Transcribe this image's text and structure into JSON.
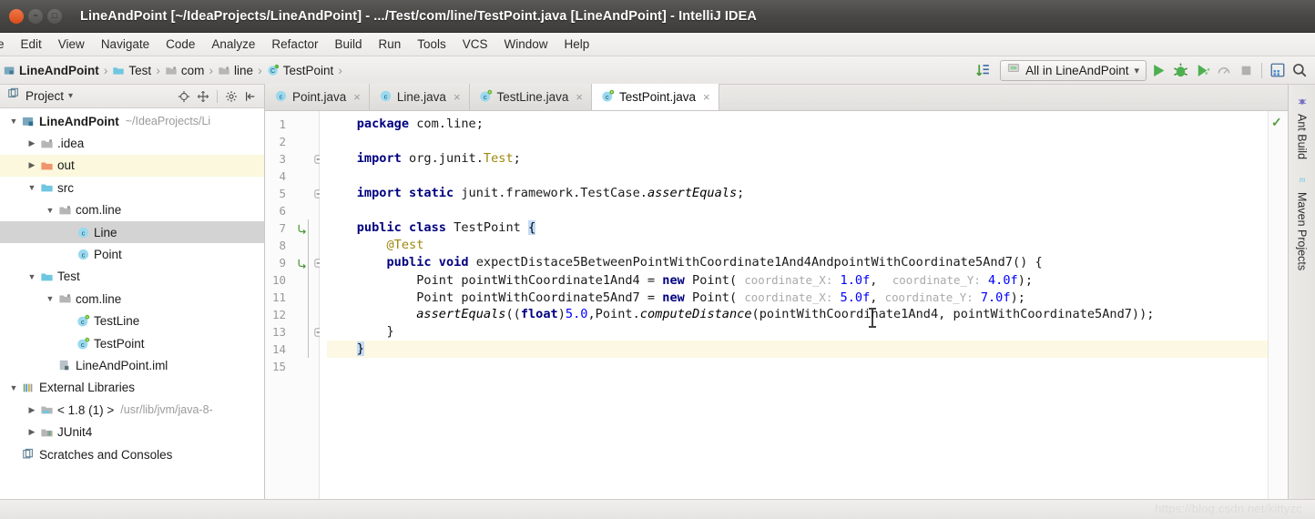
{
  "window": {
    "title": "LineAndPoint [~/IdeaProjects/LineAndPoint] - .../Test/com/line/TestPoint.java [LineAndPoint] - IntelliJ IDEA",
    "close_glyph": "×",
    "minimize_glyph": "−",
    "maximize_glyph": "□"
  },
  "menubar": {
    "items": [
      {
        "label": "le"
      },
      {
        "label": "Edit"
      },
      {
        "label": "View"
      },
      {
        "label": "Navigate"
      },
      {
        "label": "Code"
      },
      {
        "label": "Analyze"
      },
      {
        "label": "Refactor"
      },
      {
        "label": "Build"
      },
      {
        "label": "Run"
      },
      {
        "label": "Tools"
      },
      {
        "label": "VCS"
      },
      {
        "label": "Window"
      },
      {
        "label": "Help"
      }
    ]
  },
  "navbar": {
    "breadcrumbs": [
      {
        "label": "LineAndPoint",
        "icon": "module-icon"
      },
      {
        "label": "Test",
        "icon": "source-folder-icon"
      },
      {
        "label": "com",
        "icon": "folder-icon"
      },
      {
        "label": "line",
        "icon": "folder-icon"
      },
      {
        "label": "TestPoint",
        "icon": "test-class-icon"
      }
    ],
    "separator": "›",
    "run_config": "All in LineAndPoint",
    "dropdown_glyph": "▾",
    "toolbar_icons": [
      "sort-lines-icon",
      "run-icon",
      "debug-icon",
      "run-with-coverage-icon",
      "profiler-icon",
      "stop-icon",
      "settings-grid-icon",
      "search-everywhere-icon"
    ]
  },
  "sidebar": {
    "title": "Project",
    "dropdown_glyph": "▾",
    "header_icons": [
      "locate-icon",
      "expand-collapse-icon",
      "gear-icon",
      "hide-icon"
    ],
    "tree": [
      {
        "indent": 0,
        "arrow": "down",
        "icon": "module-icon",
        "label": "LineAndPoint",
        "bold": true,
        "path": "~/IdeaProjects/Li",
        "state": "normal"
      },
      {
        "indent": 1,
        "arrow": "right",
        "icon": "folder-icon",
        "label": ".idea",
        "bold": false,
        "path": "",
        "state": "normal"
      },
      {
        "indent": 1,
        "arrow": "right",
        "icon": "folder-orange-icon",
        "label": "out",
        "bold": false,
        "path": "",
        "state": "highlight"
      },
      {
        "indent": 1,
        "arrow": "down",
        "icon": "folder-src-icon",
        "label": "src",
        "bold": false,
        "path": "",
        "state": "normal"
      },
      {
        "indent": 2,
        "arrow": "down",
        "icon": "package-icon",
        "label": "com.line",
        "bold": false,
        "path": "",
        "state": "normal"
      },
      {
        "indent": 3,
        "arrow": "none",
        "icon": "class-icon",
        "label": "Line",
        "bold": false,
        "path": "",
        "state": "selected"
      },
      {
        "indent": 3,
        "arrow": "none",
        "icon": "class-icon",
        "label": "Point",
        "bold": false,
        "path": "",
        "state": "normal"
      },
      {
        "indent": 1,
        "arrow": "down",
        "icon": "folder-test-icon",
        "label": "Test",
        "bold": false,
        "path": "",
        "state": "normal"
      },
      {
        "indent": 2,
        "arrow": "down",
        "icon": "package-icon",
        "label": "com.line",
        "bold": false,
        "path": "",
        "state": "normal"
      },
      {
        "indent": 3,
        "arrow": "none",
        "icon": "test-class-icon",
        "label": "TestLine",
        "bold": false,
        "path": "",
        "state": "normal"
      },
      {
        "indent": 3,
        "arrow": "none",
        "icon": "test-class-icon",
        "label": "TestPoint",
        "bold": false,
        "path": "",
        "state": "normal"
      },
      {
        "indent": 2,
        "arrow": "none",
        "icon": "iml-file-icon",
        "label": "LineAndPoint.iml",
        "bold": false,
        "path": "",
        "state": "normal"
      },
      {
        "indent": 0,
        "arrow": "down",
        "icon": "libraries-icon",
        "label": "External Libraries",
        "bold": false,
        "path": "",
        "state": "normal"
      },
      {
        "indent": 1,
        "arrow": "right",
        "icon": "jdk-icon",
        "label": "< 1.8 (1) >",
        "bold": false,
        "path": "/usr/lib/jvm/java-8-",
        "state": "normal"
      },
      {
        "indent": 1,
        "arrow": "right",
        "icon": "library-icon",
        "label": "JUnit4",
        "bold": false,
        "path": "",
        "state": "normal"
      },
      {
        "indent": 0,
        "arrow": "none",
        "icon": "scratches-icon",
        "label": "Scratches and Consoles",
        "bold": false,
        "path": "",
        "state": "normal"
      }
    ]
  },
  "editor": {
    "tabs": [
      {
        "label": "Point.java",
        "icon": "class-icon",
        "active": false,
        "close": "×"
      },
      {
        "label": "Line.java",
        "icon": "class-icon",
        "active": false,
        "close": "×"
      },
      {
        "label": "TestLine.java",
        "icon": "test-class-icon",
        "active": false,
        "close": "×"
      },
      {
        "label": "TestPoint.java",
        "icon": "test-class-icon",
        "active": true,
        "close": "×"
      }
    ],
    "line_numbers": [
      "1",
      "2",
      "3",
      "4",
      "5",
      "6",
      "7",
      "8",
      "9",
      "10",
      "11",
      "12",
      "13",
      "14",
      "15"
    ],
    "inspection_status": "✓",
    "code_lines": [
      {
        "n": 1,
        "indent": 4,
        "caret": false,
        "tokens": [
          {
            "t": "package ",
            "c": "k"
          },
          {
            "t": "com.line;",
            "c": "pln"
          }
        ]
      },
      {
        "n": 2,
        "indent": 4,
        "caret": false,
        "tokens": []
      },
      {
        "n": 3,
        "indent": 4,
        "caret": false,
        "tokens": [
          {
            "t": "import ",
            "c": "k"
          },
          {
            "t": "org.junit.",
            "c": "pln"
          },
          {
            "t": "Test",
            "c": "an"
          },
          {
            "t": ";",
            "c": "pln"
          }
        ]
      },
      {
        "n": 4,
        "indent": 4,
        "caret": false,
        "tokens": []
      },
      {
        "n": 5,
        "indent": 4,
        "caret": false,
        "tokens": [
          {
            "t": "import static ",
            "c": "k"
          },
          {
            "t": "junit.framework.TestCase.",
            "c": "pln"
          },
          {
            "t": "assertEquals",
            "c": "it"
          },
          {
            "t": ";",
            "c": "pln"
          }
        ]
      },
      {
        "n": 6,
        "indent": 4,
        "caret": false,
        "tokens": []
      },
      {
        "n": 7,
        "indent": 4,
        "caret": false,
        "tokens": [
          {
            "t": "public class ",
            "c": "k"
          },
          {
            "t": "TestPoint ",
            "c": "pln"
          },
          {
            "t": "{",
            "c": "brmatch"
          }
        ]
      },
      {
        "n": 8,
        "indent": 8,
        "caret": false,
        "tokens": [
          {
            "t": "@Test",
            "c": "an"
          }
        ]
      },
      {
        "n": 9,
        "indent": 8,
        "caret": false,
        "tokens": [
          {
            "t": "public void ",
            "c": "k"
          },
          {
            "t": "expectDistace5BetweenPointWithCoordinate1And4AndpointWithCoordinate5And7() {",
            "c": "pln"
          }
        ]
      },
      {
        "n": 10,
        "indent": 12,
        "caret": false,
        "tokens": [
          {
            "t": "Point pointWithCoordinate1And4 = ",
            "c": "pln"
          },
          {
            "t": "new ",
            "c": "k"
          },
          {
            "t": "Point( ",
            "c": "pln"
          },
          {
            "t": "coordinate_X:",
            "c": "hint"
          },
          {
            "t": " ",
            "c": "pln"
          },
          {
            "t": "1.0f",
            "c": "num"
          },
          {
            "t": ",  ",
            "c": "pln"
          },
          {
            "t": "coordinate_Y:",
            "c": "hint"
          },
          {
            "t": " ",
            "c": "pln"
          },
          {
            "t": "4.0f",
            "c": "num"
          },
          {
            "t": ");",
            "c": "pln"
          }
        ]
      },
      {
        "n": 11,
        "indent": 12,
        "caret": false,
        "tokens": [
          {
            "t": "Point pointWithCoordinate5And7 = ",
            "c": "pln"
          },
          {
            "t": "new ",
            "c": "k"
          },
          {
            "t": "Point( ",
            "c": "pln"
          },
          {
            "t": "coordinate_X:",
            "c": "hint"
          },
          {
            "t": " ",
            "c": "pln"
          },
          {
            "t": "5.0f",
            "c": "num"
          },
          {
            "t": ", ",
            "c": "pln"
          },
          {
            "t": "coordinate_Y:",
            "c": "hint"
          },
          {
            "t": " ",
            "c": "pln"
          },
          {
            "t": "7.0f",
            "c": "num"
          },
          {
            "t": ");",
            "c": "pln"
          }
        ]
      },
      {
        "n": 12,
        "indent": 12,
        "caret": false,
        "tokens": [
          {
            "t": "assertEquals",
            "c": "it"
          },
          {
            "t": "((",
            "c": "pln"
          },
          {
            "t": "float",
            "c": "k"
          },
          {
            "t": ")",
            "c": "pln"
          },
          {
            "t": "5.0",
            "c": "num"
          },
          {
            "t": ",Point.",
            "c": "pln"
          },
          {
            "t": "computeDistance",
            "c": "it"
          },
          {
            "t": "(pointWithCoordinate1And4, pointWithCoordinate5And7));",
            "c": "pln"
          }
        ]
      },
      {
        "n": 13,
        "indent": 8,
        "caret": false,
        "tokens": [
          {
            "t": "}",
            "c": "pln"
          }
        ]
      },
      {
        "n": 14,
        "indent": 4,
        "caret": true,
        "tokens": [
          {
            "t": "}",
            "c": "brmatch"
          }
        ]
      },
      {
        "n": 15,
        "indent": 4,
        "caret": false,
        "tokens": []
      }
    ],
    "gutter_marks": [
      {
        "line": 3,
        "type": "fold-collapse"
      },
      {
        "line": 5,
        "type": "fold-collapse"
      },
      {
        "line": 7,
        "type": "run-gutter"
      },
      {
        "line": 9,
        "type": "run-gutter"
      },
      {
        "line": 9,
        "type": "fold-collapse"
      },
      {
        "line": 13,
        "type": "fold-collapse"
      }
    ]
  },
  "right_strip": {
    "tabs": [
      {
        "label": "Ant Build",
        "icon": "ant-icon"
      },
      {
        "label": "Maven Projects",
        "icon": "maven-icon"
      }
    ]
  },
  "status": {
    "watermark": "https://blog.csdn.net/kittyzc"
  },
  "colors": {
    "titlebar": "#48464a",
    "accent_green": "#4caf50",
    "selection_gray": "#d3d3d3",
    "highlight_yellow": "#fbf8dd",
    "caret_line": "#fdf8e3",
    "keyword_blue": "#000080",
    "number_blue": "#0000ff",
    "annotation_olive": "#9e880d",
    "hint_gray": "#a9a9a9"
  }
}
